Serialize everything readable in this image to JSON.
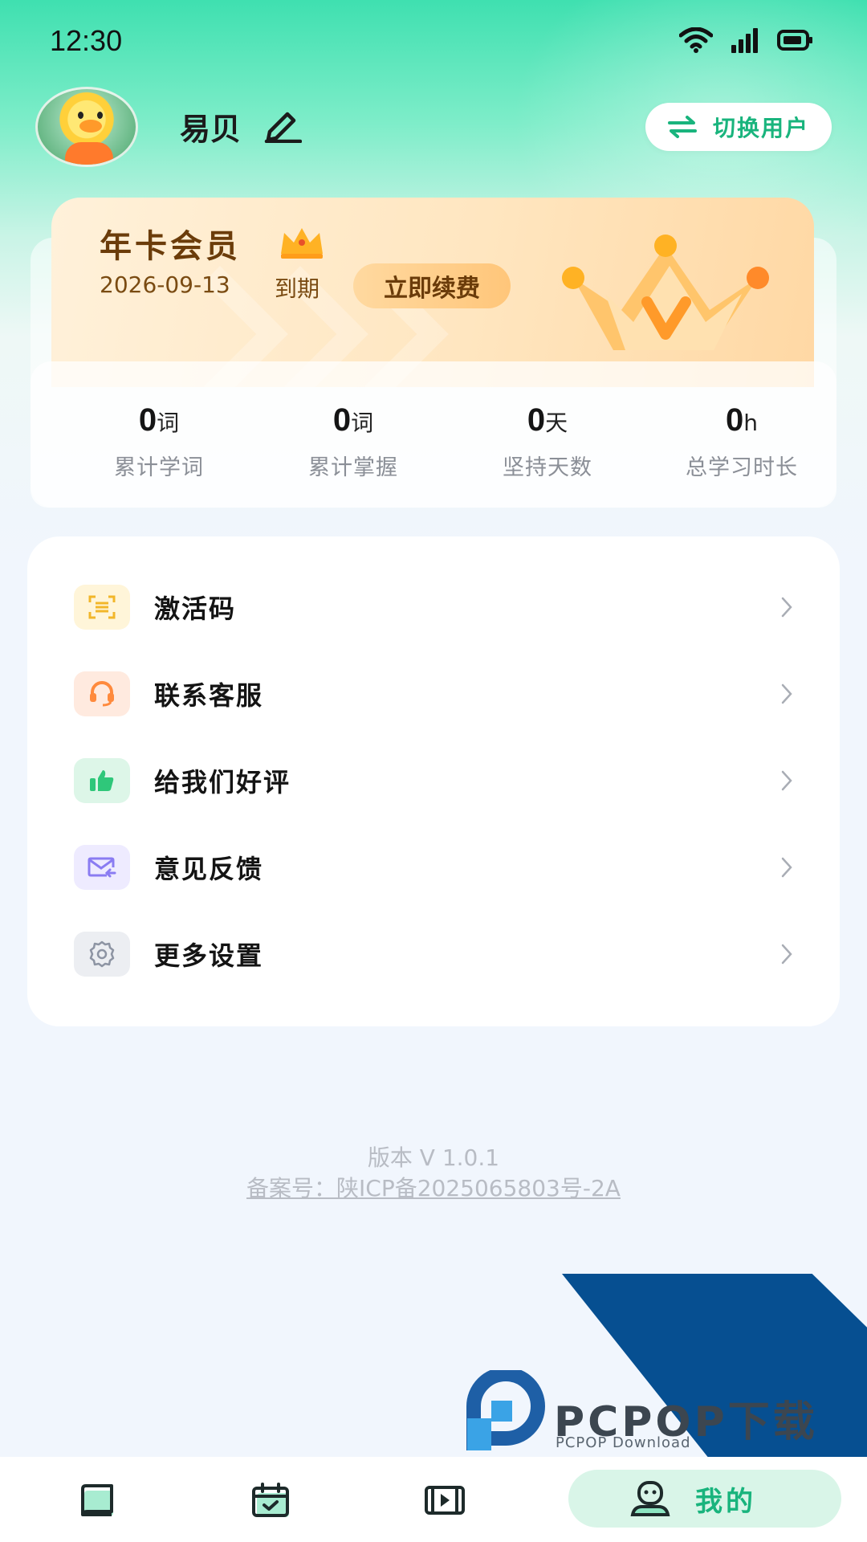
{
  "status_bar": {
    "time": "12:30",
    "icons": [
      "wifi-icon",
      "signal-icon",
      "battery-icon"
    ]
  },
  "profile": {
    "username": "易贝",
    "switch_user_label": "切换用户"
  },
  "membership": {
    "title": "年卡会员",
    "expiry_date": "2026-09-13",
    "expiry_suffix": "到期",
    "renew_label": "立即续费"
  },
  "stats": [
    {
      "value": "0",
      "unit": "词",
      "label": "累计学词"
    },
    {
      "value": "0",
      "unit": "词",
      "label": "累计掌握"
    },
    {
      "value": "0",
      "unit": "天",
      "label": "坚持天数"
    },
    {
      "value": "0",
      "unit": "h",
      "label": "总学习时长"
    }
  ],
  "menu": [
    {
      "label": "激活码",
      "icon": "scan-icon",
      "color": "#f7c63c"
    },
    {
      "label": "联系客服",
      "icon": "headset-icon",
      "color": "#ff8a3d"
    },
    {
      "label": "给我们好评",
      "icon": "thumbs-up-icon",
      "color": "#2fc77a"
    },
    {
      "label": "意见反馈",
      "icon": "mail-icon",
      "color": "#8a7cf2"
    },
    {
      "label": "更多设置",
      "icon": "gear-icon",
      "color": "#8d94a3"
    }
  ],
  "footer": {
    "version": "版本 V 1.0.1",
    "icp": "备案号：陕ICP备2025065803号-2A"
  },
  "bottom_nav": {
    "items": [
      "book-icon",
      "calendar-check-icon",
      "video-icon"
    ],
    "active_label": "我的",
    "active_icon": "user-icon"
  },
  "watermark": {
    "text": "PCPOP下载",
    "subtext": "PCPOP Download"
  },
  "colors": {
    "accent": "#19b47d",
    "gold_text": "#6b3c0a"
  }
}
